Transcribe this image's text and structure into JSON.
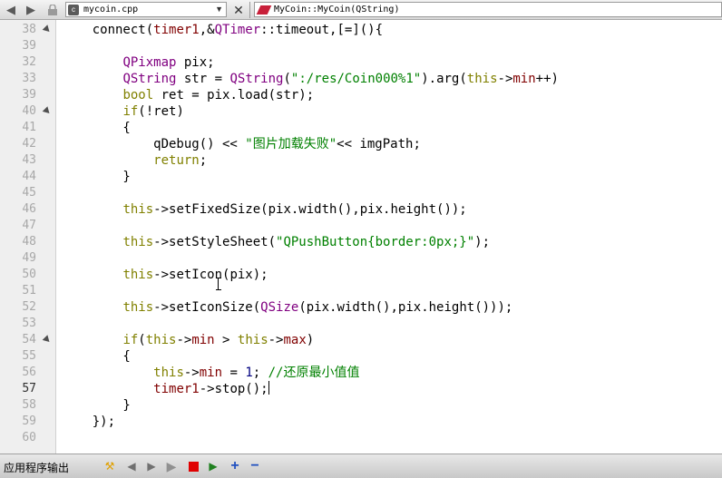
{
  "toolbar": {
    "back_icon": "back-arrow-icon",
    "forward_icon": "forward-arrow-icon",
    "lock_icon": "lock-icon",
    "file_name": "mycoin.cpp",
    "close_icon": "close-icon",
    "function_name": "MyCoin::MyCoin(QString)"
  },
  "editor": {
    "current_line": "57",
    "lines": [
      {
        "n": "38",
        "fold": true,
        "tokens": [
          {
            "t": "    connect(",
            "c": "#000000"
          },
          {
            "t": "timer1",
            "c": "#800000"
          },
          {
            "t": ",&",
            "c": "#000000"
          },
          {
            "t": "QTimer",
            "c": "#800080"
          },
          {
            "t": "::timeout,[=](){",
            "c": "#000000"
          }
        ]
      },
      {
        "n": "39",
        "tokens": []
      },
      {
        "n": "32",
        "tokens": [
          {
            "t": "        ",
            "c": "#000000"
          },
          {
            "t": "QPixmap",
            "c": "#800080"
          },
          {
            "t": " pix;",
            "c": "#000000"
          }
        ]
      },
      {
        "n": "33",
        "tokens": [
          {
            "t": "        ",
            "c": "#000000"
          },
          {
            "t": "QString",
            "c": "#800080"
          },
          {
            "t": " str = ",
            "c": "#000000"
          },
          {
            "t": "QString",
            "c": "#800080"
          },
          {
            "t": "(",
            "c": "#000000"
          },
          {
            "t": "\":/res/Coin000%1\"",
            "c": "#008000"
          },
          {
            "t": ").arg(",
            "c": "#000000"
          },
          {
            "t": "this",
            "c": "#808000"
          },
          {
            "t": "->",
            "c": "#000000"
          },
          {
            "t": "min",
            "c": "#800000"
          },
          {
            "t": "++)",
            "c": "#000000"
          }
        ]
      },
      {
        "n": "39",
        "tokens": [
          {
            "t": "        ",
            "c": "#000000"
          },
          {
            "t": "bool",
            "c": "#808000"
          },
          {
            "t": " ret = pix.load(str);",
            "c": "#000000"
          }
        ]
      },
      {
        "n": "40",
        "fold": true,
        "tokens": [
          {
            "t": "        ",
            "c": "#000000"
          },
          {
            "t": "if",
            "c": "#808000"
          },
          {
            "t": "(!ret)",
            "c": "#000000"
          }
        ]
      },
      {
        "n": "41",
        "tokens": [
          {
            "t": "        {",
            "c": "#000000"
          }
        ]
      },
      {
        "n": "42",
        "tokens": [
          {
            "t": "            qDebug() << ",
            "c": "#000000"
          },
          {
            "t": "\"图片加载失败\"",
            "c": "#008000"
          },
          {
            "t": "<< imgPath;",
            "c": "#000000"
          }
        ]
      },
      {
        "n": "43",
        "tokens": [
          {
            "t": "            ",
            "c": "#000000"
          },
          {
            "t": "return",
            "c": "#808000"
          },
          {
            "t": ";",
            "c": "#000000"
          }
        ]
      },
      {
        "n": "44",
        "tokens": [
          {
            "t": "        }",
            "c": "#000000"
          }
        ]
      },
      {
        "n": "45",
        "tokens": []
      },
      {
        "n": "46",
        "tokens": [
          {
            "t": "        ",
            "c": "#000000"
          },
          {
            "t": "this",
            "c": "#808000"
          },
          {
            "t": "->setFixedSize(pix.width(),pix.height());",
            "c": "#000000"
          }
        ]
      },
      {
        "n": "47",
        "tokens": []
      },
      {
        "n": "48",
        "tokens": [
          {
            "t": "        ",
            "c": "#000000"
          },
          {
            "t": "this",
            "c": "#808000"
          },
          {
            "t": "->setStyleSheet(",
            "c": "#000000"
          },
          {
            "t": "\"QPushButton{border:0px;}\"",
            "c": "#008000"
          },
          {
            "t": ");",
            "c": "#000000"
          }
        ]
      },
      {
        "n": "49",
        "tokens": []
      },
      {
        "n": "50",
        "tokens": [
          {
            "t": "        ",
            "c": "#000000"
          },
          {
            "t": "this",
            "c": "#808000"
          },
          {
            "t": "->setIcon(pix);",
            "c": "#000000"
          }
        ]
      },
      {
        "n": "51",
        "tokens": []
      },
      {
        "n": "52",
        "tokens": [
          {
            "t": "        ",
            "c": "#000000"
          },
          {
            "t": "this",
            "c": "#808000"
          },
          {
            "t": "->setIconSize(",
            "c": "#000000"
          },
          {
            "t": "QSize",
            "c": "#800080"
          },
          {
            "t": "(pix.width(),pix.height()));",
            "c": "#000000"
          }
        ]
      },
      {
        "n": "53",
        "tokens": []
      },
      {
        "n": "54",
        "fold": true,
        "tokens": [
          {
            "t": "        ",
            "c": "#000000"
          },
          {
            "t": "if",
            "c": "#808000"
          },
          {
            "t": "(",
            "c": "#000000"
          },
          {
            "t": "this",
            "c": "#808000"
          },
          {
            "t": "->",
            "c": "#000000"
          },
          {
            "t": "min",
            "c": "#800000"
          },
          {
            "t": " > ",
            "c": "#000000"
          },
          {
            "t": "this",
            "c": "#808000"
          },
          {
            "t": "->",
            "c": "#000000"
          },
          {
            "t": "max",
            "c": "#800000"
          },
          {
            "t": ")",
            "c": "#000000"
          }
        ]
      },
      {
        "n": "55",
        "tokens": [
          {
            "t": "        {",
            "c": "#000000"
          }
        ]
      },
      {
        "n": "56",
        "tokens": [
          {
            "t": "            ",
            "c": "#000000"
          },
          {
            "t": "this",
            "c": "#808000"
          },
          {
            "t": "->",
            "c": "#000000"
          },
          {
            "t": "min",
            "c": "#800000"
          },
          {
            "t": " = ",
            "c": "#000000"
          },
          {
            "t": "1",
            "c": "#000080"
          },
          {
            "t": "; ",
            "c": "#000000"
          },
          {
            "t": "//还原最小值值",
            "c": "#008000"
          }
        ]
      },
      {
        "n": "57",
        "cursor": true,
        "tokens": [
          {
            "t": "            ",
            "c": "#000000"
          },
          {
            "t": "timer1",
            "c": "#800000"
          },
          {
            "t": "->stop();",
            "c": "#000000"
          }
        ]
      },
      {
        "n": "58",
        "tokens": [
          {
            "t": "        }",
            "c": "#000000"
          }
        ]
      },
      {
        "n": "59",
        "tokens": [
          {
            "t": "    });",
            "c": "#000000"
          }
        ]
      },
      {
        "n": "60",
        "tokens": []
      },
      {
        "n": "",
        "tokens": []
      }
    ]
  },
  "bottom": {
    "output_label": "应用程序输出",
    "icons": [
      "build-icon",
      "prev-icon",
      "next-icon",
      "run-icon",
      "stop-icon",
      "attach-icon",
      "zoom-in-icon",
      "zoom-out-icon"
    ]
  }
}
